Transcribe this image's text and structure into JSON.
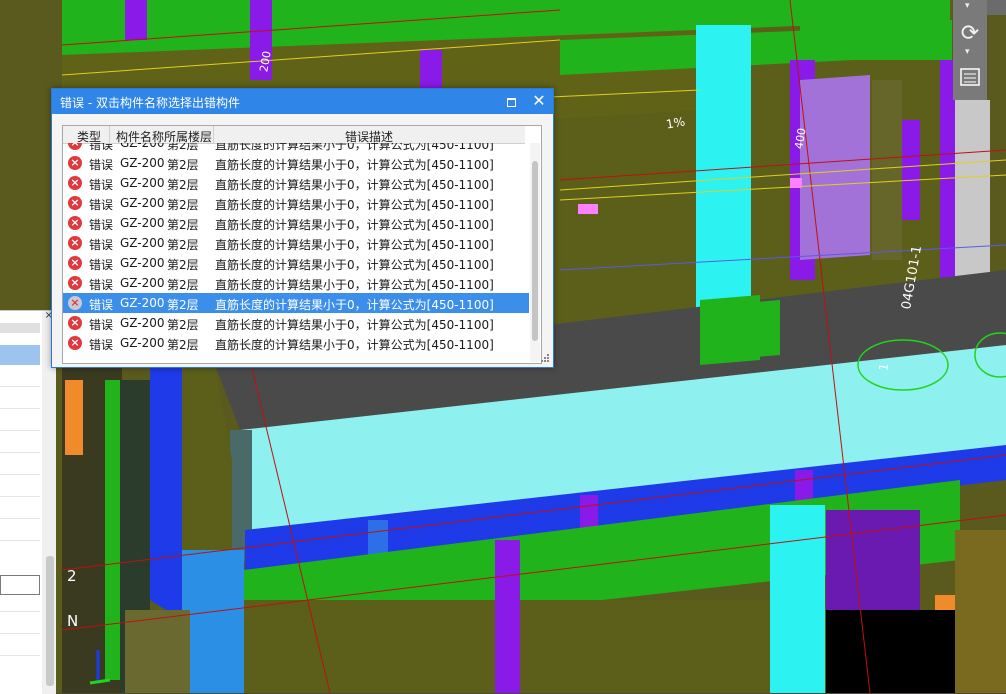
{
  "dialog": {
    "title": "错误 - 双击构件名称选择出错构件",
    "columns": [
      "类型",
      "构件名称",
      "所属楼层",
      "错误描述"
    ],
    "rows": [
      {
        "type": "错误",
        "name": "GZ-200",
        "floor": "第2层",
        "desc": "直筋长度的计算结果小于0，计算公式为[450-1100]"
      },
      {
        "type": "错误",
        "name": "GZ-200",
        "floor": "第2层",
        "desc": "直筋长度的计算结果小于0，计算公式为[450-1100]"
      },
      {
        "type": "错误",
        "name": "GZ-200",
        "floor": "第2层",
        "desc": "直筋长度的计算结果小于0，计算公式为[450-1100]"
      },
      {
        "type": "错误",
        "name": "GZ-200",
        "floor": "第2层",
        "desc": "直筋长度的计算结果小于0，计算公式为[450-1100]"
      },
      {
        "type": "错误",
        "name": "GZ-200",
        "floor": "第2层",
        "desc": "直筋长度的计算结果小于0，计算公式为[450-1100]"
      },
      {
        "type": "错误",
        "name": "GZ-200",
        "floor": "第2层",
        "desc": "直筋长度的计算结果小于0，计算公式为[450-1100]"
      },
      {
        "type": "错误",
        "name": "GZ-200",
        "floor": "第2层",
        "desc": "直筋长度的计算结果小于0，计算公式为[450-1100]"
      },
      {
        "type": "错误",
        "name": "GZ-200",
        "floor": "第2层",
        "desc": "直筋长度的计算结果小于0，计算公式为[450-1100]"
      },
      {
        "type": "错误",
        "name": "GZ-200",
        "floor": "第2层",
        "desc": "直筋长度的计算结果小于0，计算公式为[450-1100]"
      },
      {
        "type": "错误",
        "name": "GZ-200",
        "floor": "第2层",
        "desc": "直筋长度的计算结果小于0，计算公式为[450-1100]"
      },
      {
        "type": "错误",
        "name": "GZ-200",
        "floor": "第2层",
        "desc": "直筋长度的计算结果小于0，计算公式为[450-1100]"
      }
    ],
    "selected_row": 8
  },
  "viewport": {
    "labels": {
      "slope": "1%",
      "grid_2": "2",
      "grid_n": "N",
      "grid_1": "1",
      "atlas": "04G101-1",
      "dim_200": "200",
      "dim_400": "400"
    }
  },
  "icons": {
    "row_status": "error-x-icon",
    "toolbar_rotate": "rotate-icon",
    "toolbar_layers": "layers-icon",
    "close": "close-icon",
    "maximize": "maximize-icon"
  },
  "colors": {
    "title_bar": "#2f86e8",
    "selection": "#3b8fea",
    "error": "#e0383d"
  }
}
